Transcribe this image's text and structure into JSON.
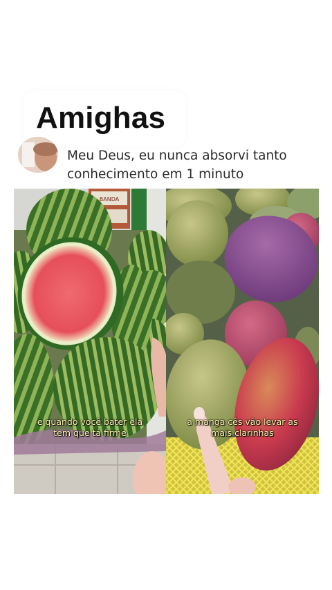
{
  "post": {
    "title": "Amighas",
    "comment": "Meu Deus, eu nunca absorvi tanto conhecimento em 1 minuto"
  },
  "panels": {
    "left_caption_line1": "e quando você bater ela",
    "left_caption_line2": "tem que tá firme",
    "right_caption_line1": "a manga cês vão levar as",
    "right_caption_line2": "mais clarinhas",
    "crate_label": "BANDA"
  },
  "colors": {
    "caption_text": "#fff7b0",
    "watermelon_rind": "#3d7a2c",
    "watermelon_flesh": "#e8505a",
    "mango_green": "#a6ad62",
    "mango_red": "#c8344a",
    "mango_purple": "#8b4f96"
  }
}
